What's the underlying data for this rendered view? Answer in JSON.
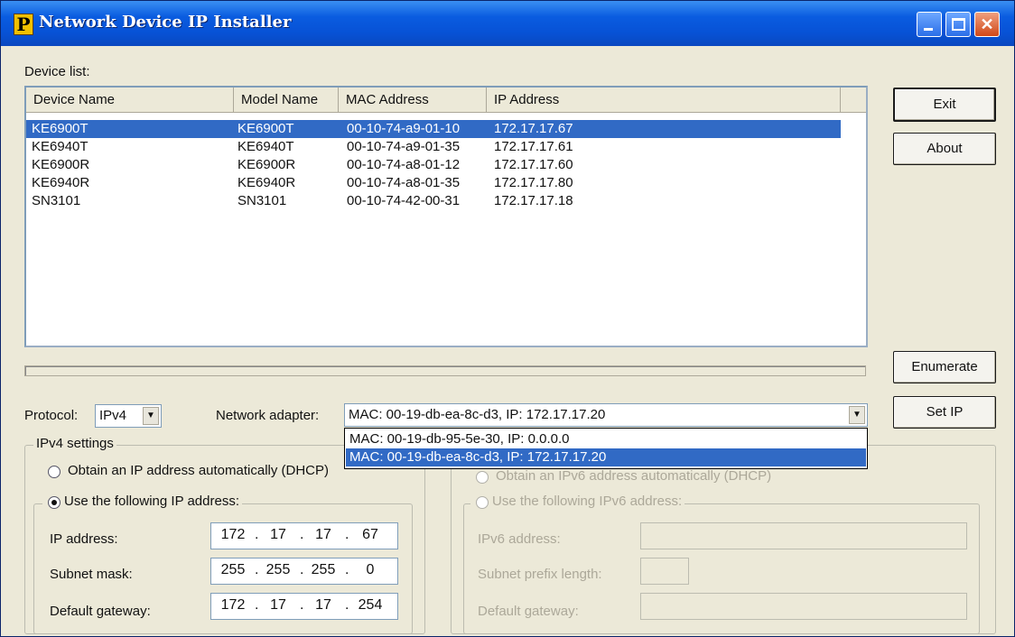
{
  "window": {
    "title": "Network Device IP Installer",
    "icon_letter": "P",
    "close_glyph": "✕"
  },
  "device_list": {
    "label": "Device list:",
    "columns": [
      "Device Name",
      "Model Name",
      "MAC Address",
      "IP Address"
    ],
    "rows": [
      {
        "device": "KE6900T",
        "model": "KE6900T",
        "mac": "00-10-74-a9-01-10",
        "ip": "172.17.17.67",
        "selected": true
      },
      {
        "device": "KE6940T",
        "model": "KE6940T",
        "mac": "00-10-74-a9-01-35",
        "ip": "172.17.17.61",
        "selected": false
      },
      {
        "device": "KE6900R",
        "model": "KE6900R",
        "mac": "00-10-74-a8-01-12",
        "ip": "172.17.17.60",
        "selected": false
      },
      {
        "device": "KE6940R",
        "model": "KE6940R",
        "mac": "00-10-74-a8-01-35",
        "ip": "172.17.17.80",
        "selected": false
      },
      {
        "device": "SN3101",
        "model": "SN3101",
        "mac": "00-10-74-42-00-31",
        "ip": "172.17.17.18",
        "selected": false
      }
    ]
  },
  "buttons": {
    "exit": "Exit",
    "about": "About",
    "enumerate": "Enumerate",
    "set_ip": "Set IP"
  },
  "protocol": {
    "label": "Protocol:",
    "value": "IPv4"
  },
  "network_adapter": {
    "label": "Network adapter:",
    "value": "MAC: 00-19-db-ea-8c-d3,  IP: 172.17.17.20",
    "options": [
      {
        "label": "MAC: 00-19-db-95-5e-30,  IP: 0.0.0.0",
        "selected": false
      },
      {
        "label": "MAC: 00-19-db-ea-8c-d3,  IP: 172.17.17.20",
        "selected": true
      }
    ]
  },
  "ipv4_settings": {
    "title": "IPv4 settings",
    "dhcp_label": "Obtain an IP address automatically (DHCP)",
    "static_label": "Use the following IP address:",
    "mode": "static",
    "ip_address_label": "IP address:",
    "ip_address": [
      "172",
      "17",
      "17",
      "67"
    ],
    "subnet_label": "Subnet mask:",
    "subnet": [
      "255",
      "255",
      "255",
      "0"
    ],
    "gateway_label": "Default gateway:",
    "gateway": [
      "172",
      "17",
      "17",
      "254"
    ]
  },
  "ipv6_settings": {
    "dhcp_label": "Obtain an IPv6 address automatically (DHCP)",
    "static_label": "Use the following IPv6 address:",
    "address_label": "IPv6 address:",
    "prefix_label": "Subnet prefix length:",
    "gateway_label": "Default gateway:",
    "enabled": false
  },
  "colors": {
    "title_bar": "#0752d6",
    "selection": "#316ac5",
    "window_bg": "#ece9d8"
  }
}
